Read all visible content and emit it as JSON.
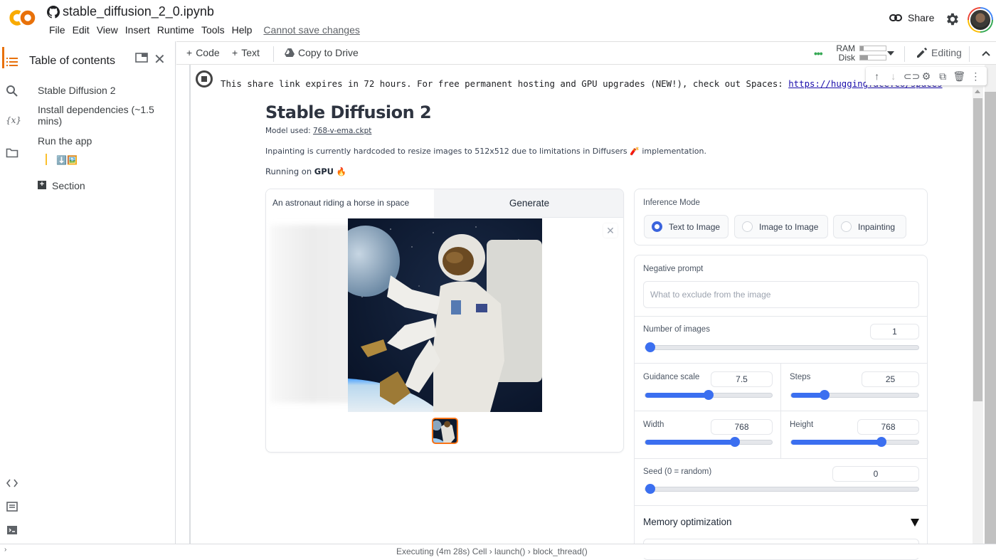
{
  "app": {
    "notebook_title": "stable_diffusion_2_0.ipynb",
    "menus": [
      "File",
      "Edit",
      "View",
      "Insert",
      "Runtime",
      "Tools",
      "Help"
    ],
    "save_status": "Cannot save changes",
    "share_label": "Share"
  },
  "toolbar": {
    "add_code": "Code",
    "add_text": "Text",
    "copy_to_drive": "Copy to Drive",
    "ram_label": "RAM",
    "disk_label": "Disk",
    "ram_usage": 0.15,
    "disk_usage": 0.3,
    "editing_label": "Editing"
  },
  "toc": {
    "title": "Table of contents",
    "items": [
      {
        "label": "Stable Diffusion 2"
      },
      {
        "label": "Install dependencies (~1.5 mins)"
      },
      {
        "label": "Run the app"
      },
      {
        "label": "⬇️🖼️"
      },
      {
        "label": "Section"
      }
    ]
  },
  "cell_output": {
    "message": "This share link expires in 72 hours. For free permanent hosting and GPU upgrades (NEW!), check out Spaces: ",
    "link_text": "https://huggingface.co/spaces"
  },
  "gradio": {
    "title": "Stable Diffusion 2",
    "model_prefix": "Model used: ",
    "model_name": "768-v-ema.ckpt",
    "note": "Inpainting is currently hardcoded to resize images to 512x512 due to limitations in Diffusers 🧨 implementation.",
    "running_prefix": "Running on ",
    "running_device": "GPU",
    "running_icon": "🔥",
    "prompt_value": "An astronaut riding a horse in space",
    "generate_label": "Generate",
    "inference_mode": {
      "label": "Inference Mode",
      "options": [
        "Text to Image",
        "Image to Image",
        "Inpainting"
      ],
      "selected": "Text to Image"
    },
    "negative_prompt": {
      "label": "Negative prompt",
      "placeholder": "What to exclude from the image"
    },
    "num_images": {
      "label": "Number of images",
      "value": "1",
      "fraction": 0.0
    },
    "guidance_scale": {
      "label": "Guidance scale",
      "value": "7.5",
      "fraction": 0.5
    },
    "steps": {
      "label": "Steps",
      "value": "25",
      "fraction": 0.26
    },
    "width": {
      "label": "Width",
      "value": "768",
      "fraction": 0.71
    },
    "height": {
      "label": "Height",
      "value": "768",
      "fraction": 0.71
    },
    "seed": {
      "label": "Seed (0 = random)",
      "value": "0",
      "fraction": 0.0
    },
    "memory_optimization": "Memory optimization"
  },
  "status_bar": {
    "text": "Executing (4m 28s)  Cell › launch() › block_thread()"
  }
}
